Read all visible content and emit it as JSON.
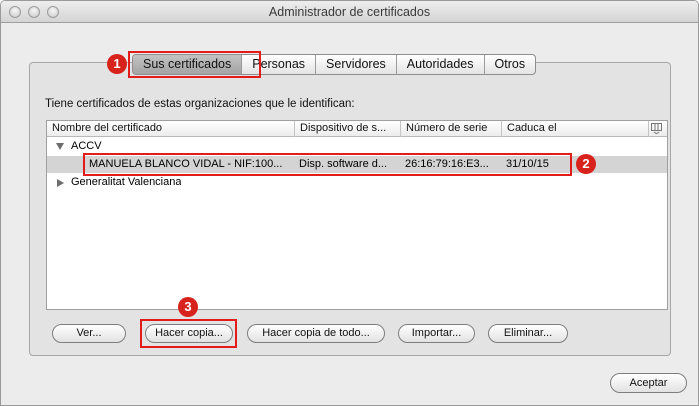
{
  "window": {
    "title": "Administrador de certificados"
  },
  "tabs": [
    {
      "label": "Sus certificados",
      "selected": true
    },
    {
      "label": "Personas"
    },
    {
      "label": "Servidores"
    },
    {
      "label": "Autoridades"
    },
    {
      "label": "Otros"
    }
  ],
  "intro_text": "Tiene certificados de estas organizaciones que le identifican:",
  "table": {
    "columns": [
      "Nombre del certificado",
      "Dispositivo de s...",
      "Número de serie",
      "Caduca el"
    ],
    "groups": [
      {
        "name": "ACCV",
        "expanded": true,
        "rows": [
          {
            "name": "MANUELA BLANCO VIDAL - NIF:100...",
            "device": "Disp. software d...",
            "serial": "26:16:79:16:E3...",
            "expires": "31/10/15",
            "selected": true
          }
        ]
      },
      {
        "name": "Generalitat Valenciana",
        "expanded": false,
        "rows": []
      }
    ]
  },
  "buttons": {
    "view": "Ver...",
    "backup": "Hacer copia...",
    "backup_all": "Hacer copia de todo...",
    "import": "Importar...",
    "delete": "Eliminar...",
    "accept": "Aceptar"
  },
  "annotations": [
    "1",
    "2",
    "3"
  ],
  "colors": {
    "highlight": "#e21b1b",
    "badge": "#d8231d",
    "selected_row": "#d4d4d4"
  }
}
